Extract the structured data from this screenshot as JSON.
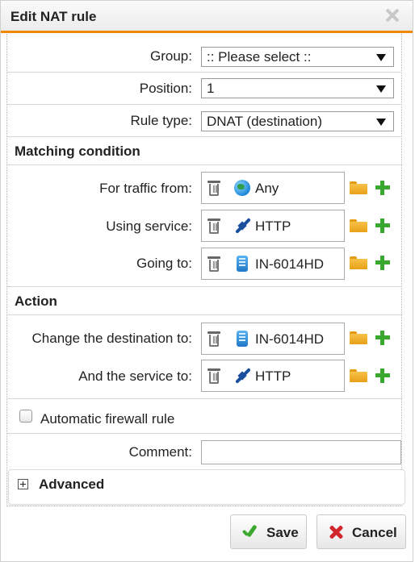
{
  "dialog": {
    "title": "Edit NAT rule"
  },
  "fields": {
    "group": {
      "label": "Group:",
      "value": ":: Please select ::"
    },
    "position": {
      "label": "Position:",
      "value": "1"
    },
    "rule_type": {
      "label": "Rule type:",
      "value": "DNAT (destination)"
    }
  },
  "matching": {
    "heading": "Matching condition",
    "traffic_from": {
      "label": "For traffic from:",
      "value": "Any",
      "icon": "globe-icon"
    },
    "using_service": {
      "label": "Using service:",
      "value": "HTTP",
      "icon": "service-icon"
    },
    "going_to": {
      "label": "Going to:",
      "value": "IN-6014HD",
      "icon": "host-icon"
    }
  },
  "action": {
    "heading": "Action",
    "change_destination": {
      "label": "Change the destination to:",
      "value": "IN-6014HD",
      "icon": "host-icon"
    },
    "service_to": {
      "label": "And the service to:",
      "value": "HTTP",
      "icon": "service-icon"
    }
  },
  "auto_firewall": {
    "label": "Automatic firewall rule",
    "checked": false
  },
  "comment": {
    "label": "Comment:",
    "value": ""
  },
  "advanced": {
    "label": "Advanced"
  },
  "buttons": {
    "save": "Save",
    "cancel": "Cancel"
  },
  "colors": {
    "accent": "#ef8a00",
    "add": "#3aa82f",
    "cancel": "#d0262b",
    "folder": "#f2b234"
  }
}
